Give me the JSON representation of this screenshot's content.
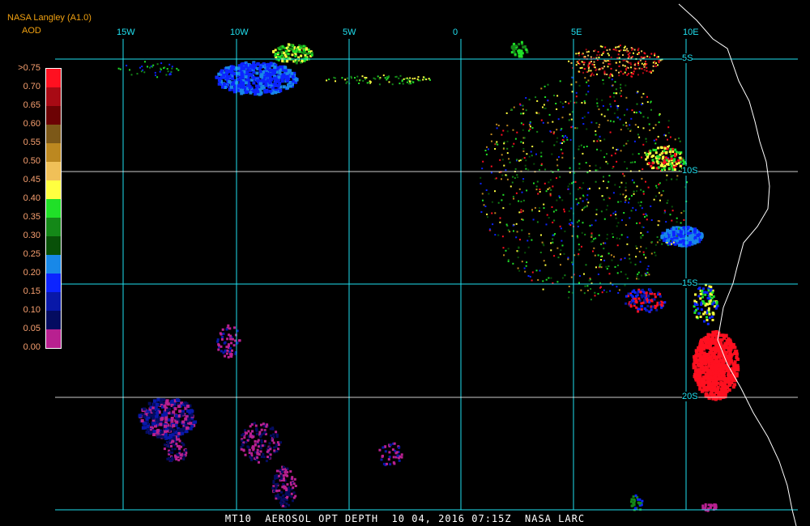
{
  "header": {
    "source": "NASA Langley (A1.0)",
    "variable": "AOD"
  },
  "legend": {
    "labels": [
      ">0.75",
      "0.70",
      "0.65",
      "0.60",
      "0.55",
      "0.50",
      "0.45",
      "0.40",
      "0.35",
      "0.30",
      "0.25",
      "0.20",
      "0.15",
      "0.10",
      "0.05",
      "0.00"
    ],
    "colors": [
      "#ff1020",
      "#a80a14",
      "#6c0204",
      "#7c5818",
      "#bc8820",
      "#f0c058",
      "#ffff40",
      "#20e028",
      "#148818",
      "#085008",
      "#1888e8",
      "#0c24ff",
      "#0818a8",
      "#040c60",
      "#b82090"
    ]
  },
  "grid": {
    "lon_labels": [
      "15W",
      "10W",
      "5W",
      "0",
      "5E",
      "10E"
    ],
    "lat_labels": [
      "5S",
      "10S",
      "15S",
      "20S"
    ],
    "line_color": "#20e0f0"
  },
  "footer": {
    "satellite": "MT10",
    "product": "AEROSOL OPT DEPTH",
    "datetime": "10 04, 2016 07:15Z",
    "agency": "NASA LARC"
  }
}
